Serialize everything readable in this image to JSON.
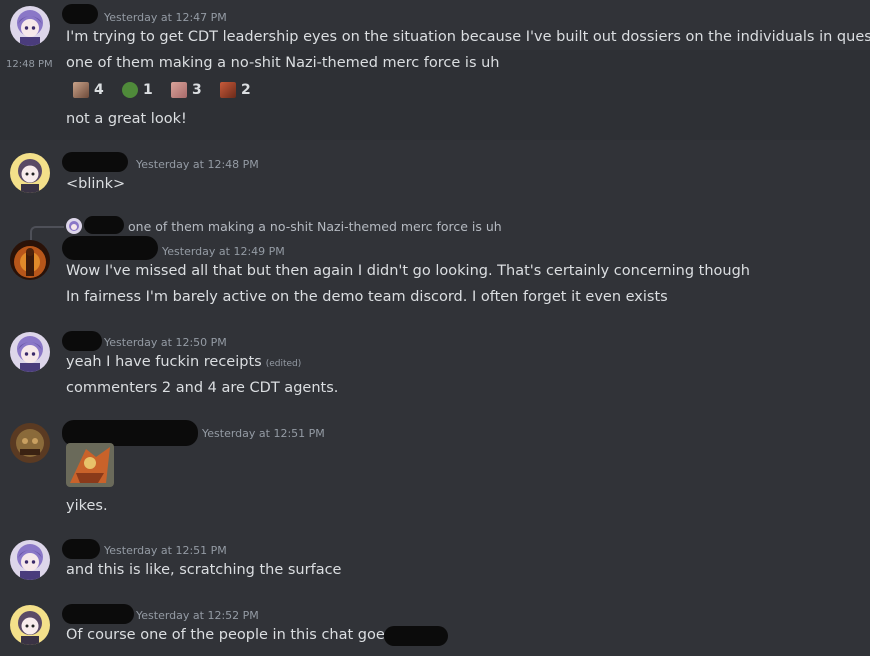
{
  "messages": [
    {
      "timestamp": "Yesterday at 12:47 PM",
      "lines": [
        "I'm trying to get CDT leadership eyes on the situation because I've built out dossiers on the individuals in question"
      ]
    },
    {
      "side_time": "12:48 PM",
      "lines": [
        "one of them making a no-shit Nazi-themed merc force is uh"
      ],
      "reactions": [
        {
          "emoji": "face-emoji",
          "count": "4"
        },
        {
          "emoji": "pepe-frog-emoji",
          "count": "1"
        },
        {
          "emoji": "face-emoji-2",
          "count": "3"
        },
        {
          "emoji": "art-emoji",
          "count": "2"
        }
      ],
      "after": "not a great look!"
    },
    {
      "timestamp": "Yesterday at 12:48 PM",
      "lines": [
        "<blink>"
      ]
    },
    {
      "reply": "one of them making a no-shit Nazi-themed merc force is uh",
      "timestamp": "Yesterday at 12:49 PM",
      "lines": [
        "Wow I've missed all that but then again I didn't go looking.  That's certainly concerning though",
        "In fairness I'm barely active on the demo team discord. I often forget it even exists"
      ]
    },
    {
      "timestamp": "Yesterday at 12:50 PM",
      "lines": [
        "yeah I have fuckin receipts",
        "commenters 2 and 4 are CDT agents."
      ],
      "edited": "(edited)"
    },
    {
      "timestamp": "Yesterday at 12:51 PM",
      "lines": [
        "yikes."
      ]
    },
    {
      "timestamp": "Yesterday at 12:51 PM",
      "lines": [
        "and this is like, scratching the surface"
      ]
    },
    {
      "timestamp": "Yesterday at 12:52 PM",
      "lines": [
        "Of course one of the people in this chat goes by"
      ]
    }
  ]
}
